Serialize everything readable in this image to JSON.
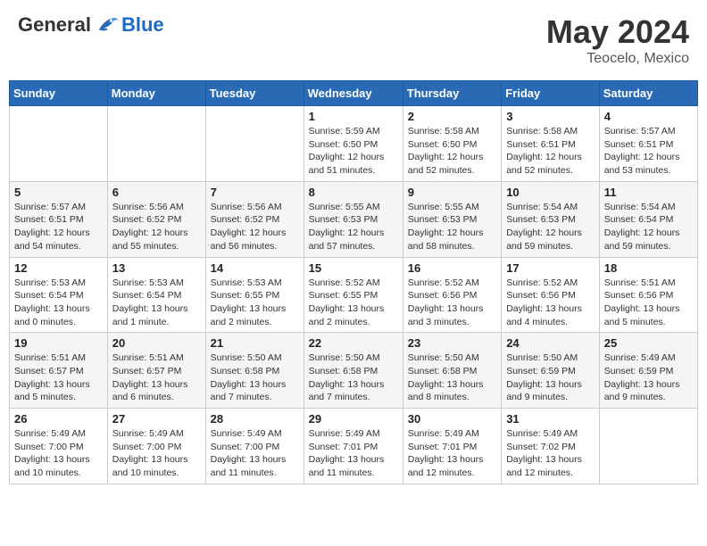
{
  "header": {
    "logo_general": "General",
    "logo_blue": "Blue",
    "month_title": "May 2024",
    "location": "Teocelo, Mexico"
  },
  "days_of_week": [
    "Sunday",
    "Monday",
    "Tuesday",
    "Wednesday",
    "Thursday",
    "Friday",
    "Saturday"
  ],
  "weeks": [
    [
      {
        "day": "",
        "info": ""
      },
      {
        "day": "",
        "info": ""
      },
      {
        "day": "",
        "info": ""
      },
      {
        "day": "1",
        "info": "Sunrise: 5:59 AM\nSunset: 6:50 PM\nDaylight: 12 hours\nand 51 minutes."
      },
      {
        "day": "2",
        "info": "Sunrise: 5:58 AM\nSunset: 6:50 PM\nDaylight: 12 hours\nand 52 minutes."
      },
      {
        "day": "3",
        "info": "Sunrise: 5:58 AM\nSunset: 6:51 PM\nDaylight: 12 hours\nand 52 minutes."
      },
      {
        "day": "4",
        "info": "Sunrise: 5:57 AM\nSunset: 6:51 PM\nDaylight: 12 hours\nand 53 minutes."
      }
    ],
    [
      {
        "day": "5",
        "info": "Sunrise: 5:57 AM\nSunset: 6:51 PM\nDaylight: 12 hours\nand 54 minutes."
      },
      {
        "day": "6",
        "info": "Sunrise: 5:56 AM\nSunset: 6:52 PM\nDaylight: 12 hours\nand 55 minutes."
      },
      {
        "day": "7",
        "info": "Sunrise: 5:56 AM\nSunset: 6:52 PM\nDaylight: 12 hours\nand 56 minutes."
      },
      {
        "day": "8",
        "info": "Sunrise: 5:55 AM\nSunset: 6:53 PM\nDaylight: 12 hours\nand 57 minutes."
      },
      {
        "day": "9",
        "info": "Sunrise: 5:55 AM\nSunset: 6:53 PM\nDaylight: 12 hours\nand 58 minutes."
      },
      {
        "day": "10",
        "info": "Sunrise: 5:54 AM\nSunset: 6:53 PM\nDaylight: 12 hours\nand 59 minutes."
      },
      {
        "day": "11",
        "info": "Sunrise: 5:54 AM\nSunset: 6:54 PM\nDaylight: 12 hours\nand 59 minutes."
      }
    ],
    [
      {
        "day": "12",
        "info": "Sunrise: 5:53 AM\nSunset: 6:54 PM\nDaylight: 13 hours\nand 0 minutes."
      },
      {
        "day": "13",
        "info": "Sunrise: 5:53 AM\nSunset: 6:54 PM\nDaylight: 13 hours\nand 1 minute."
      },
      {
        "day": "14",
        "info": "Sunrise: 5:53 AM\nSunset: 6:55 PM\nDaylight: 13 hours\nand 2 minutes."
      },
      {
        "day": "15",
        "info": "Sunrise: 5:52 AM\nSunset: 6:55 PM\nDaylight: 13 hours\nand 2 minutes."
      },
      {
        "day": "16",
        "info": "Sunrise: 5:52 AM\nSunset: 6:56 PM\nDaylight: 13 hours\nand 3 minutes."
      },
      {
        "day": "17",
        "info": "Sunrise: 5:52 AM\nSunset: 6:56 PM\nDaylight: 13 hours\nand 4 minutes."
      },
      {
        "day": "18",
        "info": "Sunrise: 5:51 AM\nSunset: 6:56 PM\nDaylight: 13 hours\nand 5 minutes."
      }
    ],
    [
      {
        "day": "19",
        "info": "Sunrise: 5:51 AM\nSunset: 6:57 PM\nDaylight: 13 hours\nand 5 minutes."
      },
      {
        "day": "20",
        "info": "Sunrise: 5:51 AM\nSunset: 6:57 PM\nDaylight: 13 hours\nand 6 minutes."
      },
      {
        "day": "21",
        "info": "Sunrise: 5:50 AM\nSunset: 6:58 PM\nDaylight: 13 hours\nand 7 minutes."
      },
      {
        "day": "22",
        "info": "Sunrise: 5:50 AM\nSunset: 6:58 PM\nDaylight: 13 hours\nand 7 minutes."
      },
      {
        "day": "23",
        "info": "Sunrise: 5:50 AM\nSunset: 6:58 PM\nDaylight: 13 hours\nand 8 minutes."
      },
      {
        "day": "24",
        "info": "Sunrise: 5:50 AM\nSunset: 6:59 PM\nDaylight: 13 hours\nand 9 minutes."
      },
      {
        "day": "25",
        "info": "Sunrise: 5:49 AM\nSunset: 6:59 PM\nDaylight: 13 hours\nand 9 minutes."
      }
    ],
    [
      {
        "day": "26",
        "info": "Sunrise: 5:49 AM\nSunset: 7:00 PM\nDaylight: 13 hours\nand 10 minutes."
      },
      {
        "day": "27",
        "info": "Sunrise: 5:49 AM\nSunset: 7:00 PM\nDaylight: 13 hours\nand 10 minutes."
      },
      {
        "day": "28",
        "info": "Sunrise: 5:49 AM\nSunset: 7:00 PM\nDaylight: 13 hours\nand 11 minutes."
      },
      {
        "day": "29",
        "info": "Sunrise: 5:49 AM\nSunset: 7:01 PM\nDaylight: 13 hours\nand 11 minutes."
      },
      {
        "day": "30",
        "info": "Sunrise: 5:49 AM\nSunset: 7:01 PM\nDaylight: 13 hours\nand 12 minutes."
      },
      {
        "day": "31",
        "info": "Sunrise: 5:49 AM\nSunset: 7:02 PM\nDaylight: 13 hours\nand 12 minutes."
      },
      {
        "day": "",
        "info": ""
      }
    ]
  ]
}
